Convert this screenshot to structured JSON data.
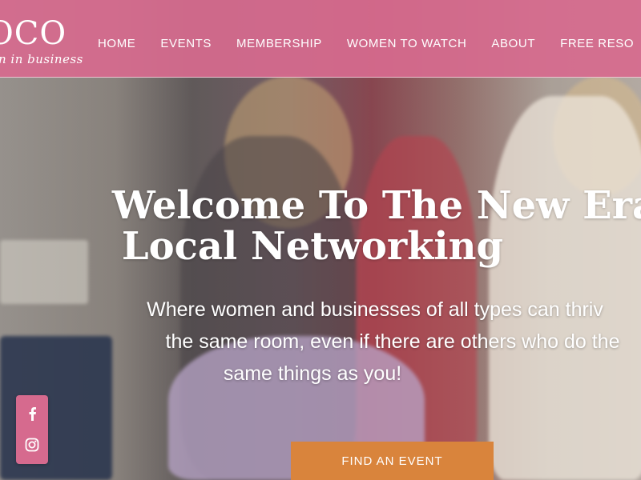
{
  "brand": {
    "logo_word": "OCO",
    "tagline": "n in business",
    "colors": {
      "header_pink": "#d66a8e",
      "cta_orange": "#d9843c",
      "text": "#ffffff"
    }
  },
  "nav": {
    "items": [
      {
        "label": "HOME"
      },
      {
        "label": "EVENTS"
      },
      {
        "label": "MEMBERSHIP"
      },
      {
        "label": "WOMEN TO WATCH"
      },
      {
        "label": "ABOUT"
      },
      {
        "label": "FREE RESO"
      }
    ]
  },
  "hero": {
    "title_line1": "Welcome To The New Era",
    "title_line2": "Local Networking",
    "subtitle_line1": "Where women and businesses of all types can thriv",
    "subtitle_line2": "the same room, even if there are others who do the",
    "subtitle_line3": "same things as you!",
    "cta_label": "FIND AN EVENT"
  },
  "social": {
    "items": [
      {
        "name": "facebook-icon"
      },
      {
        "name": "instagram-icon"
      }
    ]
  }
}
